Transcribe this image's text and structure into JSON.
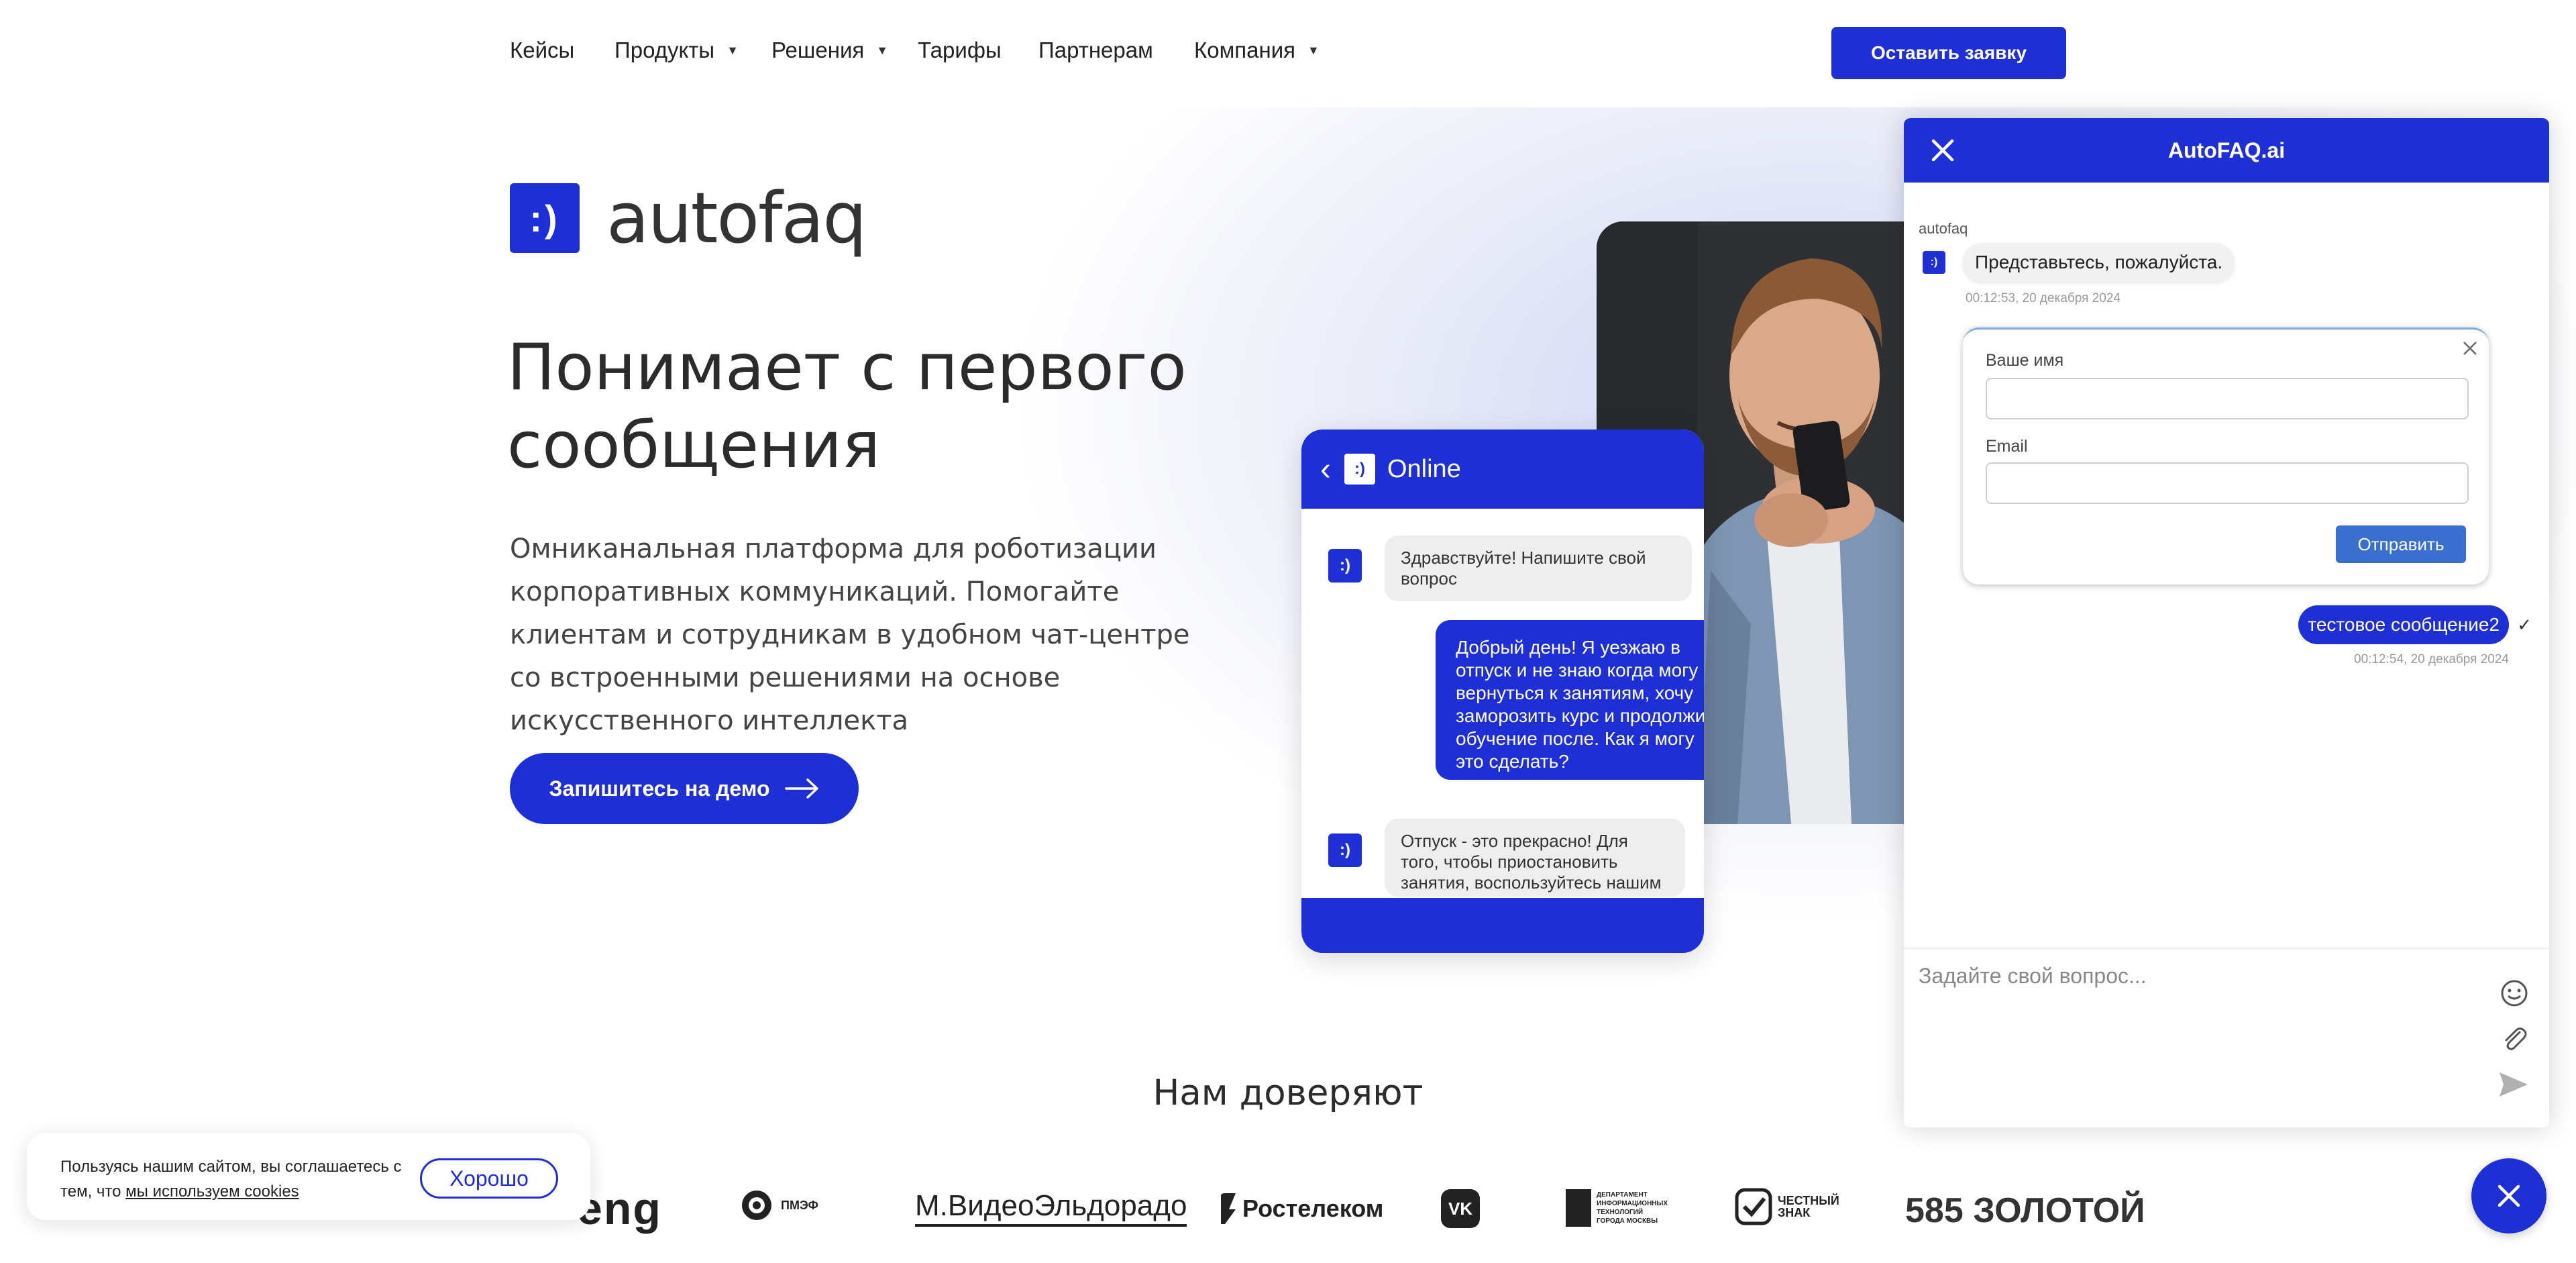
{
  "nav": {
    "items": [
      {
        "label": "Кейсы",
        "dropdown": false
      },
      {
        "label": "Продукты",
        "dropdown": true
      },
      {
        "label": "Решения",
        "dropdown": true
      },
      {
        "label": "Тарифы",
        "dropdown": false
      },
      {
        "label": "Партнерам",
        "dropdown": false
      },
      {
        "label": "Компания",
        "dropdown": true
      }
    ],
    "cta_label": "Оставить заявку"
  },
  "hero": {
    "logo_mark": ":)",
    "logo_text": "autofaq",
    "title": "Понимает с первого сообщения",
    "description": "Омниканальная платформа для роботизации корпоративных коммуникаций. Помогайте клиентам и сотрудникам в удобном чат-центре со встроенными решениями на основе искусственного интеллекта",
    "demo_button": "Запишитесь на демо"
  },
  "mockup": {
    "status": "Online",
    "messages": [
      {
        "from": "bot",
        "text": "Здравствуйте! Напишите свой вопрос"
      },
      {
        "from": "user",
        "text": "Добрый день! Я уезжаю в отпуск и не знаю когда могу вернуться к занятиям, хочу заморозить курс и продолжить обучение после. Как я могу это сделать?"
      },
      {
        "from": "bot",
        "text": "Отпуск - это прекрасно! Для того, чтобы приостановить занятия, воспользуйтесь нашим"
      }
    ]
  },
  "trust": {
    "title": "Нам доверяют",
    "brands": [
      "eng",
      "ПМЭФ",
      "М.ВидеоЭльдорадо",
      "Ростелеком",
      "VK",
      "ДЕПАРТАМЕНТ ИНФОРМАЦИОННЫХ ТЕХНОЛОГИЙ ГОРОДА МОСКВЫ",
      "ЧЕСТНЫЙ ЗНАК",
      "585 ЗОЛОТОЙ"
    ]
  },
  "cookie": {
    "text": "Пользуясь нашим сайтом, вы соглашаетесь с тем, что",
    "link": "мы используем cookies",
    "button": "Хорошо"
  },
  "chat": {
    "title": "AutoFAQ.ai",
    "sender": "autofaq",
    "bot_message": "Представьтесь, пожалуйста.",
    "bot_time": "00:12:53, 20 декабря 2024",
    "form": {
      "name_label": "Ваше имя",
      "email_label": "Email",
      "submit": "Отправить"
    },
    "user_message": "тестовое сообщение2",
    "user_time": "00:12:54, 20 декабря 2024",
    "input_placeholder": "Задайте свой вопрос..."
  },
  "colors": {
    "accent": "#1e2fd6",
    "form_button": "#3a6fd0"
  }
}
